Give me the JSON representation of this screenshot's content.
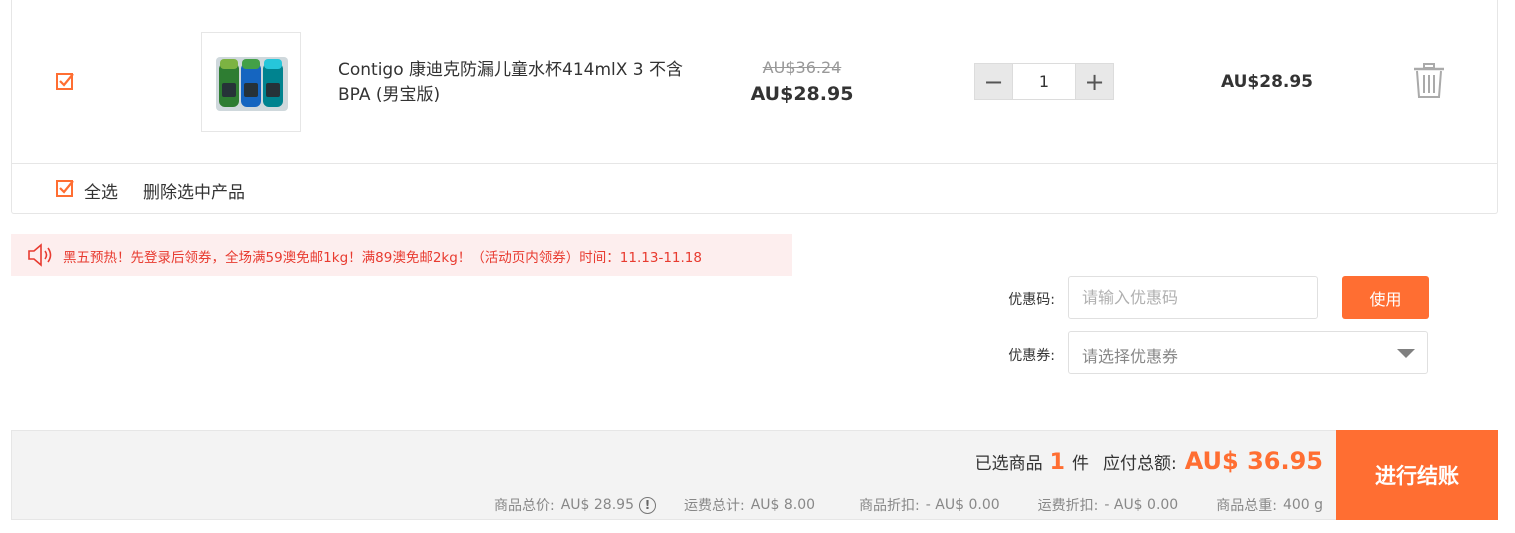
{
  "cart_item": {
    "name": "Contigo 康迪克防漏儿童水杯414mlX 3 不含BPA (男宝版)",
    "price_original": "AU$36.24",
    "price_current": "AU$28.95",
    "quantity": "1",
    "subtotal": "AU$28.95",
    "checked": true,
    "image_icon": "water-bottles-product-image"
  },
  "qty_controls": {
    "minus": "−",
    "plus": "+"
  },
  "select_all": {
    "label": "全选",
    "checked": true
  },
  "delete_selected": "删除选中产品",
  "notice": {
    "text": "黑五预热！先登录后领券，全场满59澳免邮1kg！满89澳免邮2kg！（活动页内领券）时间：11.13-11.18",
    "icon": "speaker-icon",
    "color": "#e83b30"
  },
  "promo": {
    "code_label": "优惠码:",
    "code_placeholder": "请输入优惠码",
    "use_button": "使用",
    "coupon_label": "优惠券:",
    "coupon_placeholder": "请选择优惠券"
  },
  "summary": {
    "selected_prefix": "已选商品",
    "selected_count": "1",
    "selected_suffix": "件",
    "total_label": "应付总额:",
    "total_value": "AU$ 36.95",
    "goods_total_label": "商品总价:",
    "goods_total_value": "AU$ 28.95",
    "shipping_label": "运费总计:",
    "shipping_value": "AU$ 8.00",
    "discount_label": "商品折扣:",
    "discount_value": "- AU$ 0.00",
    "shipping_discount_label": "运费折扣:",
    "shipping_discount_value": "- AU$ 0.00",
    "weight_label": "商品总重:",
    "weight_value": "400 g",
    "info_icon": "!"
  },
  "checkout_button": "进行结账",
  "colors": {
    "accent": "#ff6e32",
    "notice_bg": "#fdeeee",
    "summary_bg": "#f3f3f3"
  }
}
